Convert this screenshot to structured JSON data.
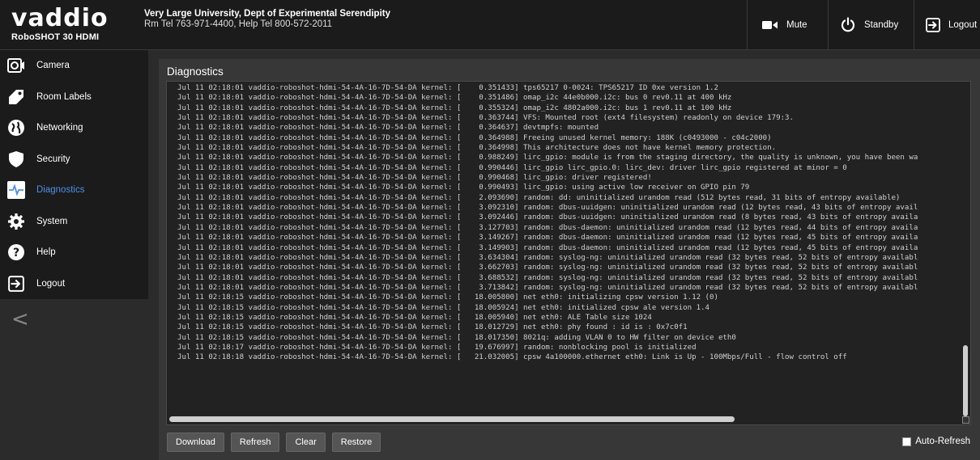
{
  "brand": {
    "logo_text": "vaddio",
    "model": "RoboSHOT 30 HDMI"
  },
  "org": {
    "name": "Very Large University, Dept of Experimental Serendipity",
    "tel": "Rm Tel 763-971-4400, Help Tel 800-572-2011"
  },
  "header_buttons": {
    "mute": "Mute",
    "standby": "Standby",
    "logout": "Logout"
  },
  "nav": [
    {
      "label": "Camera",
      "icon": "camera-icon"
    },
    {
      "label": "Room Labels",
      "icon": "tag-icon"
    },
    {
      "label": "Networking",
      "icon": "globe-icon"
    },
    {
      "label": "Security",
      "icon": "shield-icon"
    },
    {
      "label": "Diagnostics",
      "icon": "pulse-icon",
      "active": true
    },
    {
      "label": "System",
      "icon": "gear-icon"
    },
    {
      "label": "Help",
      "icon": "question-icon"
    },
    {
      "label": "Logout",
      "icon": "logout-icon"
    }
  ],
  "collapse_glyph": "<",
  "panel": {
    "title": "Diagnostics"
  },
  "log_prefix": "Jul 11 02:18:01 vaddio-roboshot-hdmi-54-4A-16-7D-54-DA kernel: [",
  "log": [
    "Jul 11 02:18:01 vaddio-roboshot-hdmi-54-4A-16-7D-54-DA kernel: [    0.351433] tps65217 0-0024: TPS65217 ID 0xe version 1.2",
    "Jul 11 02:18:01 vaddio-roboshot-hdmi-54-4A-16-7D-54-DA kernel: [    0.351486] omap_i2c 44e0b000.i2c: bus 0 rev0.11 at 400 kHz",
    "Jul 11 02:18:01 vaddio-roboshot-hdmi-54-4A-16-7D-54-DA kernel: [    0.355324] omap_i2c 4802a000.i2c: bus 1 rev0.11 at 100 kHz",
    "Jul 11 02:18:01 vaddio-roboshot-hdmi-54-4A-16-7D-54-DA kernel: [    0.363744] VFS: Mounted root (ext4 filesystem) readonly on device 179:3.",
    "Jul 11 02:18:01 vaddio-roboshot-hdmi-54-4A-16-7D-54-DA kernel: [    0.364637] devtmpfs: mounted",
    "Jul 11 02:18:01 vaddio-roboshot-hdmi-54-4A-16-7D-54-DA kernel: [    0.364988] Freeing unused kernel memory: 188K (c0493000 - c04c2000)",
    "Jul 11 02:18:01 vaddio-roboshot-hdmi-54-4A-16-7D-54-DA kernel: [    0.364998] This architecture does not have kernel memory protection.",
    "Jul 11 02:18:01 vaddio-roboshot-hdmi-54-4A-16-7D-54-DA kernel: [    0.988249] lirc_gpio: module is from the staging directory, the quality is unknown, you have been wa",
    "Jul 11 02:18:01 vaddio-roboshot-hdmi-54-4A-16-7D-54-DA kernel: [    0.990446] lirc_gpio lirc_gpio.0: lirc_dev: driver lirc_gpio registered at minor = 0",
    "Jul 11 02:18:01 vaddio-roboshot-hdmi-54-4A-16-7D-54-DA kernel: [    0.990468] lirc_gpio: driver registered!",
    "Jul 11 02:18:01 vaddio-roboshot-hdmi-54-4A-16-7D-54-DA kernel: [    0.990493] lirc_gpio: using active low receiver on GPIO pin 79",
    "Jul 11 02:18:01 vaddio-roboshot-hdmi-54-4A-16-7D-54-DA kernel: [    2.093690] random: dd: uninitialized urandom read (512 bytes read, 31 bits of entropy available)",
    "Jul 11 02:18:01 vaddio-roboshot-hdmi-54-4A-16-7D-54-DA kernel: [    3.092310] random: dbus-uuidgen: uninitialized urandom read (12 bytes read, 43 bits of entropy avail",
    "Jul 11 02:18:01 vaddio-roboshot-hdmi-54-4A-16-7D-54-DA kernel: [    3.092446] random: dbus-uuidgen: uninitialized urandom read (8 bytes read, 43 bits of entropy availa",
    "Jul 11 02:18:01 vaddio-roboshot-hdmi-54-4A-16-7D-54-DA kernel: [    3.127703] random: dbus-daemon: uninitialized urandom read (12 bytes read, 44 bits of entropy availa",
    "Jul 11 02:18:01 vaddio-roboshot-hdmi-54-4A-16-7D-54-DA kernel: [    3.149267] random: dbus-daemon: uninitialized urandom read (12 bytes read, 45 bits of entropy availa",
    "Jul 11 02:18:01 vaddio-roboshot-hdmi-54-4A-16-7D-54-DA kernel: [    3.149903] random: dbus-daemon: uninitialized urandom read (12 bytes read, 45 bits of entropy availa",
    "Jul 11 02:18:01 vaddio-roboshot-hdmi-54-4A-16-7D-54-DA kernel: [    3.634304] random: syslog-ng: uninitialized urandom read (32 bytes read, 52 bits of entropy availabl",
    "Jul 11 02:18:01 vaddio-roboshot-hdmi-54-4A-16-7D-54-DA kernel: [    3.662703] random: syslog-ng: uninitialized urandom read (32 bytes read, 52 bits of entropy availabl",
    "Jul 11 02:18:01 vaddio-roboshot-hdmi-54-4A-16-7D-54-DA kernel: [    3.688532] random: syslog-ng: uninitialized urandom read (32 bytes read, 52 bits of entropy availabl",
    "Jul 11 02:18:01 vaddio-roboshot-hdmi-54-4A-16-7D-54-DA kernel: [    3.713842] random: syslog-ng: uninitialized urandom read (32 bytes read, 52 bits of entropy availabl",
    "Jul 11 02:18:15 vaddio-roboshot-hdmi-54-4A-16-7D-54-DA kernel: [   18.005800] net eth0: initializing cpsw version 1.12 (0)",
    "Jul 11 02:18:15 vaddio-roboshot-hdmi-54-4A-16-7D-54-DA kernel: [   18.005924] net eth0: initialized cpsw ale version 1.4",
    "Jul 11 02:18:15 vaddio-roboshot-hdmi-54-4A-16-7D-54-DA kernel: [   18.005940] net eth0: ALE Table size 1024",
    "Jul 11 02:18:15 vaddio-roboshot-hdmi-54-4A-16-7D-54-DA kernel: [   18.012729] net eth0: phy found : id is : 0x7c0f1",
    "Jul 11 02:18:15 vaddio-roboshot-hdmi-54-4A-16-7D-54-DA kernel: [   18.017350] 8021q: adding VLAN 0 to HW filter on device eth0",
    "Jul 11 02:18:17 vaddio-roboshot-hdmi-54-4A-16-7D-54-DA kernel: [   19.676997] random: nonblocking pool is initialized",
    "Jul 11 02:18:18 vaddio-roboshot-hdmi-54-4A-16-7D-54-DA kernel: [   21.032005] cpsw 4a100000.ethernet eth0: Link is Up - 100Mbps/Full - flow control off"
  ],
  "buttons": {
    "download": "Download",
    "refresh": "Refresh",
    "clear": "Clear",
    "restore": "Restore"
  },
  "auto_refresh": {
    "label": "Auto-Refresh",
    "checked": false
  },
  "colors": {
    "accent": "#4f8fe8",
    "header_bg": "#1b1b1b",
    "panel_bg": "#373737",
    "log_bg": "#222222"
  }
}
